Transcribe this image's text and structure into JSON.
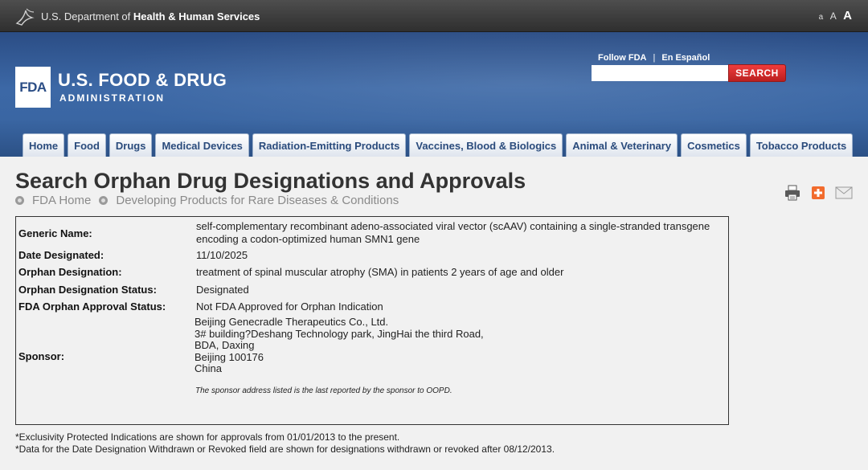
{
  "hhs_bar": {
    "department_prefix": "U.S. Department of ",
    "department_bold": "Health & Human Services",
    "text_size": [
      "a",
      "A",
      "A"
    ]
  },
  "header": {
    "fda_logo_text": "FDA",
    "agency_name": "U.S. FOOD & DRUG",
    "agency_sub": "ADMINISTRATION",
    "follow_link": "Follow FDA",
    "spanish_link": "En Español",
    "search_placeholder": "",
    "search_button": "SEARCH"
  },
  "nav": {
    "tabs": [
      "Home",
      "Food",
      "Drugs",
      "Medical Devices",
      "Radiation-Emitting Products",
      "Vaccines, Blood & Biologics",
      "Animal & Veterinary",
      "Cosmetics",
      "Tobacco Products"
    ]
  },
  "page": {
    "title": "Search Orphan Drug Designations and Approvals",
    "breadcrumb": [
      "FDA Home",
      "Developing Products for Rare Diseases & Conditions"
    ]
  },
  "details": {
    "generic_name": {
      "label": "Generic Name:",
      "value_line1": "self-complementary recombinant adeno-associated viral vector (scAAV) containing a single-stranded transgene",
      "value_line2": "encoding a codon-optimized human SMN1 gene"
    },
    "date_designated": {
      "label": "Date Designated:",
      "value": "11/10/2025"
    },
    "orphan_designation": {
      "label": "Orphan Designation:",
      "value": "treatment of spinal muscular atrophy (SMA) in patients 2 years of age and older"
    },
    "designation_status": {
      "label": "Orphan Designation Status:",
      "value": "Designated"
    },
    "approval_status": {
      "label": "FDA Orphan Approval Status:",
      "value": "Not FDA Approved for Orphan Indication"
    },
    "sponsor": {
      "label": "Sponsor:",
      "lines": [
        "Beijing Genecradle Therapeutics Co., Ltd.",
        "3# building?Deshang Technology park, JingHai the third Road,",
        "BDA, Daxing",
        "Beijing 100176",
        "China"
      ],
      "note": "The sponsor address listed is the last reported by the sponsor to OOPD."
    }
  },
  "footnotes": [
    "*Exclusivity Protected Indications are shown for approvals from 01/01/2013 to the present.",
    "*Data for the Date Designation Withdrawn or Revoked field are shown for designations withdrawn or revoked after 08/12/2013."
  ]
}
